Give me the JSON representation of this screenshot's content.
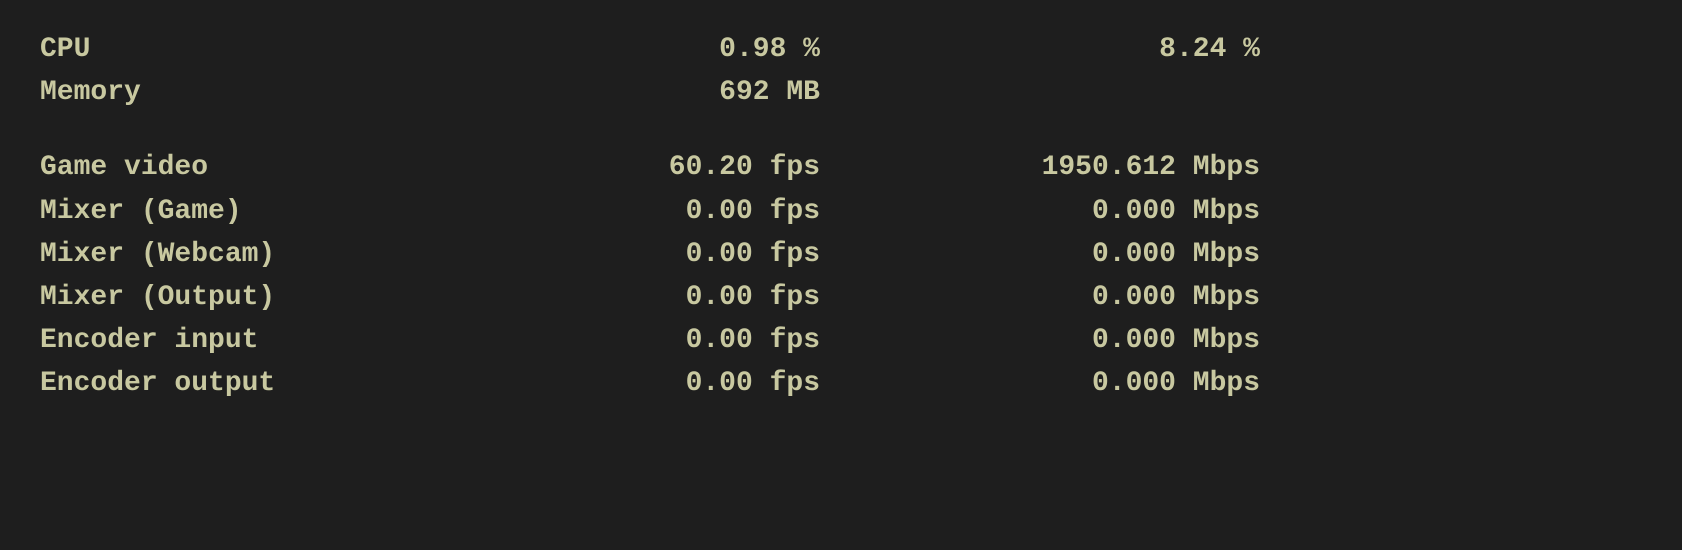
{
  "rows": [
    {
      "id": "cpu",
      "label": "CPU",
      "value1": "0.98 %",
      "value2": "8.24 %"
    },
    {
      "id": "memory",
      "label": "Memory",
      "value1": "692 MB",
      "value2": ""
    },
    {
      "id": "spacer",
      "label": "",
      "value1": "",
      "value2": ""
    },
    {
      "id": "game-video",
      "label": "Game video",
      "value1": "60.20 fps",
      "value2": "1950.612 Mbps"
    },
    {
      "id": "mixer-game",
      "label": "Mixer (Game)",
      "value1": "0.00 fps",
      "value2": "0.000 Mbps"
    },
    {
      "id": "mixer-webcam",
      "label": "Mixer (Webcam)",
      "value1": "0.00 fps",
      "value2": "0.000 Mbps"
    },
    {
      "id": "mixer-output",
      "label": "Mixer (Output)",
      "value1": "0.00 fps",
      "value2": "0.000 Mbps"
    },
    {
      "id": "encoder-input",
      "label": "Encoder input",
      "value1": "0.00 fps",
      "value2": "0.000 Mbps"
    },
    {
      "id": "encoder-output",
      "label": "Encoder output",
      "value1": "0.00 fps",
      "value2": "0.000 Mbps"
    }
  ]
}
